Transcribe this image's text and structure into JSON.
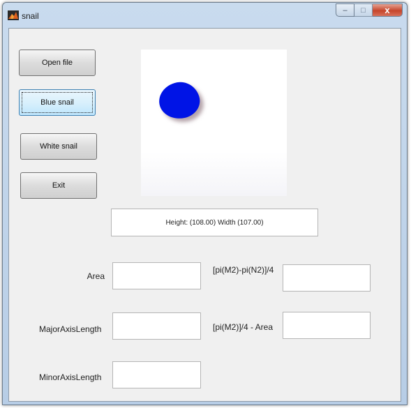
{
  "window": {
    "title": "snail",
    "controls": {
      "minimize": "–",
      "maximize": "□",
      "close": "x"
    }
  },
  "buttons": {
    "open_file": "Open file",
    "blue_snail": "Blue snail",
    "white_snail": "White snail",
    "exit": "Exit"
  },
  "image": {
    "blob_color": "#0014e6",
    "background": "#ffffff"
  },
  "readout": {
    "text": "Height: (108.00) Width (107.00)"
  },
  "labels": {
    "area": "Area",
    "major_axis": "MajorAxisLength",
    "minor_axis": "MinorAxisLength",
    "pi_diff": "[pi(M2)-pi(N2)]/4",
    "pi_area": "[pi(M2)]/4 - Area"
  },
  "fields": {
    "area": "",
    "major_axis": "",
    "minor_axis": "",
    "pi_diff": "",
    "pi_area": ""
  },
  "colors": {
    "focused_button": "#bee6fd",
    "close_button": "#c6452b",
    "panel_bg": "#f0f0f0"
  }
}
